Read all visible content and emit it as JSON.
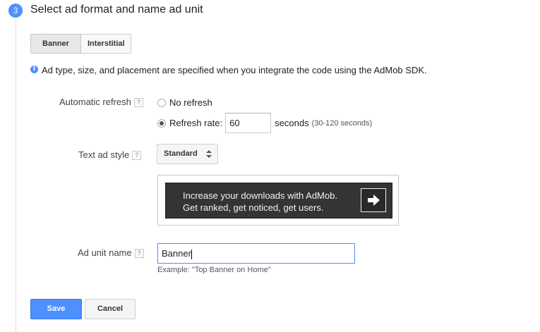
{
  "step": {
    "number": "3",
    "title": "Select ad format and name ad unit"
  },
  "format_tabs": [
    {
      "label": "Banner",
      "selected": true
    },
    {
      "label": "Interstitial",
      "selected": false
    }
  ],
  "info": {
    "icon": "info-icon",
    "text": "Ad type, size, and placement are specified when you integrate the code using the AdMob SDK."
  },
  "refresh": {
    "label": "Automatic refresh",
    "help": "?",
    "options": [
      {
        "label": "No refresh",
        "checked": false
      },
      {
        "label": "Refresh rate:",
        "checked": true
      }
    ],
    "rate_value": "60",
    "seconds_label": "seconds",
    "range_hint": "(30-120 seconds)"
  },
  "text_ad_style": {
    "label": "Text ad style",
    "help": "?",
    "selected": "Standard"
  },
  "preview": {
    "line1": "Increase your downloads with AdMob.",
    "line2": "Get ranked, get noticed, get users.",
    "button_icon": "arrow-right-icon"
  },
  "ad_unit_name": {
    "label": "Ad unit name",
    "help": "?",
    "value": "Banner",
    "example": "Example: \"Top Banner on Home\""
  },
  "actions": {
    "save_label": "Save",
    "cancel_label": "Cancel"
  },
  "colors": {
    "accent": "#4d90fe",
    "ad_background": "#333435"
  }
}
